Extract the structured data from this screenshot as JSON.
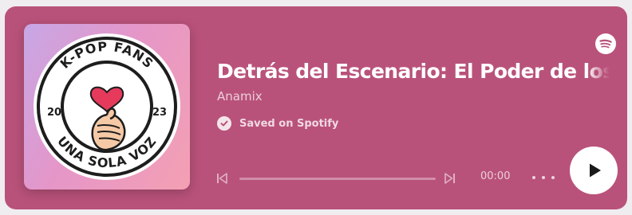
{
  "episode": {
    "title": "Detrás del Escenario: El Poder de los Fandoms",
    "artist": "Anamix",
    "saved_label": "Saved on Spotify"
  },
  "cover": {
    "badge_top": "K-POP FANS",
    "badge_bottom": "UNA SOLA VOZ",
    "year_left": "20",
    "year_right": "23"
  },
  "player": {
    "time": "00:00",
    "progress": 0.0
  },
  "icons": {
    "brand": "spotify-icon",
    "saved": "check-circle-icon",
    "prev": "skip-back-icon",
    "next": "skip-forward-icon",
    "more": "more-horizontal-icon",
    "play": "play-icon"
  },
  "colors": {
    "card_background": "#b9527a",
    "play_button": "#ffffff",
    "heart": "#e53a5c"
  }
}
